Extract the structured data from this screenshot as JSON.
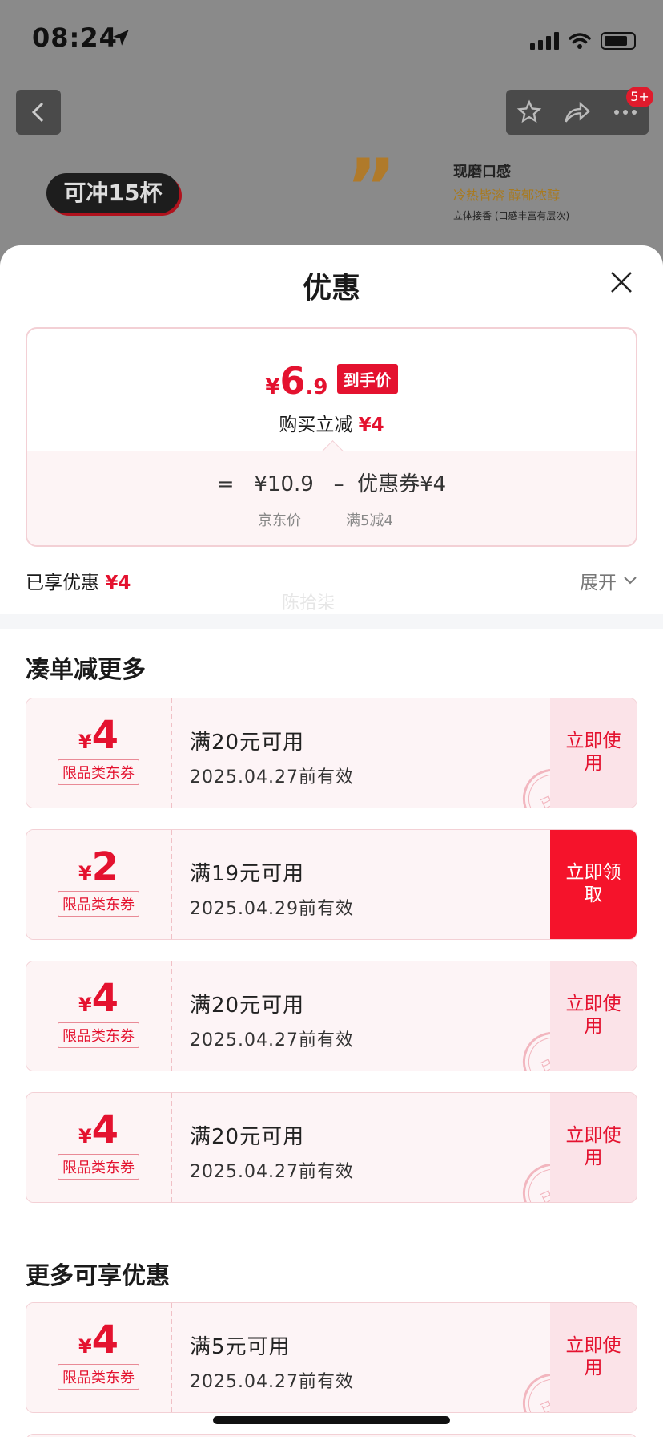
{
  "status_bar": {
    "time": "08:24"
  },
  "top_nav": {
    "badge": "5+"
  },
  "background_promo": {
    "pill": "可冲15杯",
    "card_title": "现磨口感",
    "card_sub": "冷热皆溶 醇郁浓醇",
    "card_note": "立体接香 (口感丰富有层次)"
  },
  "sheet": {
    "title": "优惠",
    "price": {
      "currency": "¥",
      "integer": "6",
      "decimal": ".9",
      "tag": "到手价",
      "instant_label": "购买立减",
      "instant_value": "¥4"
    },
    "formula": {
      "eq": "=",
      "base": "¥10.9",
      "minus": "–",
      "coupon": "优惠券¥4",
      "base_label": "京东价",
      "coupon_label": "满5减4"
    },
    "saved": {
      "label": "已享优惠",
      "value": "¥4",
      "expand": "展开"
    }
  },
  "watermark": "陈拾柒",
  "sections": {
    "more_discount": "凑单减更多",
    "more_offers": "更多可享优惠"
  },
  "coupons": [
    {
      "currency": "¥",
      "amount": "4",
      "type": "限品类东券",
      "condition": "满20元可用",
      "valid": "2025.04.27前有效",
      "action": "立即使用",
      "claimed": "已领"
    },
    {
      "currency": "¥",
      "amount": "2",
      "type": "限品类东券",
      "condition": "满19元可用",
      "valid": "2025.04.29前有效",
      "action": "立即领取",
      "claimed": ""
    },
    {
      "currency": "¥",
      "amount": "4",
      "type": "限品类东券",
      "condition": "满20元可用",
      "valid": "2025.04.27前有效",
      "action": "立即使用",
      "claimed": "已领"
    },
    {
      "currency": "¥",
      "amount": "4",
      "type": "限品类东券",
      "condition": "满20元可用",
      "valid": "2025.04.27前有效",
      "action": "立即使用",
      "claimed": "已领"
    },
    {
      "currency": "¥",
      "amount": "4",
      "type": "限品类东券",
      "condition": "满5元可用",
      "valid": "2025.04.27前有效",
      "action": "立即使用",
      "claimed": "已领"
    }
  ],
  "colors": {
    "accent_red": "#e4122f",
    "coupon_bg": "#fdf4f5",
    "overlay": "#6b6b6b"
  }
}
